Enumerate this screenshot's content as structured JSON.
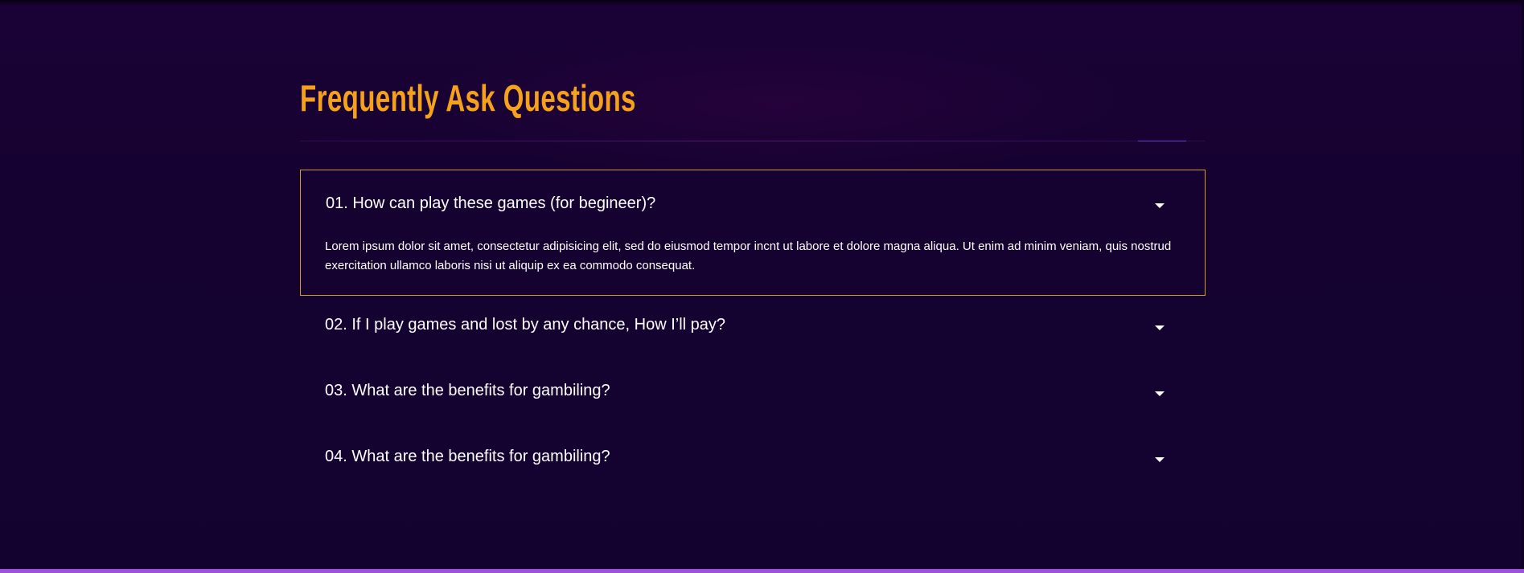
{
  "faq": {
    "title": "Frequently Ask Questions",
    "items": [
      {
        "question": "01. How can play these games (for begineer)?",
        "answer": "Lorem ipsum dolor sit amet, consectetur adipisicing elit, sed do eiusmod tempor incnt ut labore et dolore magna aliqua. Ut enim ad minim veniam, quis nostrud exercitation ullamco laboris nisi ut aliquip ex ea commodo consequat.",
        "expanded": true
      },
      {
        "question": "02. If I play games and lost by any chance, How I’ll pay?",
        "expanded": false
      },
      {
        "question": "03. What are the benefits for gambiling?",
        "expanded": false
      },
      {
        "question": "04. What are the benefits for gambiling?",
        "expanded": false
      }
    ]
  },
  "icons": {
    "caret": "caret-down-icon"
  },
  "colors": {
    "background": "#14022f",
    "title": "#f5a11b",
    "active_border": "#d69d1e",
    "text": "#ffffff",
    "bottom_bar": "#9b52d8",
    "divider_accent": "#6a3fd0"
  }
}
